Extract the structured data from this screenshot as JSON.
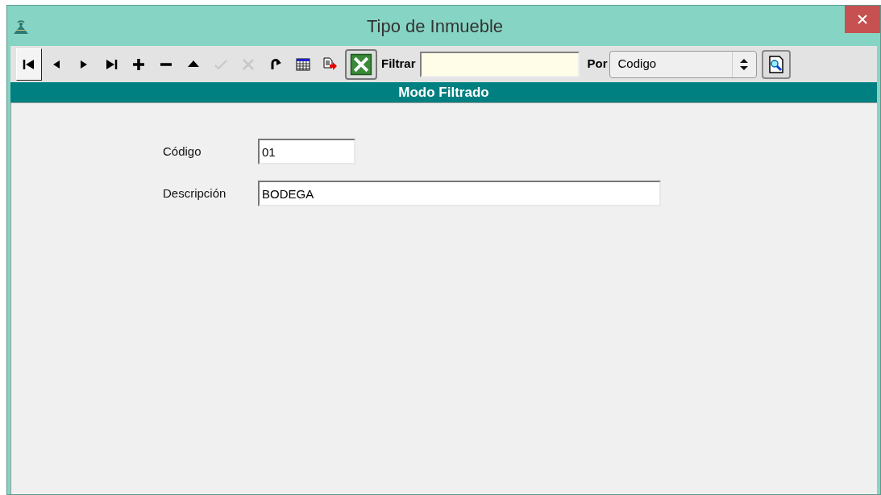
{
  "window": {
    "title": "Tipo de Inmueble"
  },
  "toolbar": {
    "buttons": [
      {
        "kind": "first",
        "pressed": true,
        "disabled": false
      },
      {
        "kind": "prev",
        "pressed": false,
        "disabled": false
      },
      {
        "kind": "next",
        "pressed": false,
        "disabled": false
      },
      {
        "kind": "last",
        "pressed": false,
        "disabled": false
      },
      {
        "kind": "add",
        "pressed": false,
        "disabled": false
      },
      {
        "kind": "remove",
        "pressed": false,
        "disabled": false
      },
      {
        "kind": "up",
        "pressed": false,
        "disabled": false
      },
      {
        "kind": "confirm",
        "pressed": false,
        "disabled": true
      },
      {
        "kind": "cancel",
        "pressed": false,
        "disabled": true
      },
      {
        "kind": "refresh",
        "pressed": false,
        "disabled": false
      },
      {
        "kind": "grid",
        "pressed": false,
        "disabled": false
      },
      {
        "kind": "export",
        "pressed": false,
        "disabled": false
      },
      {
        "kind": "excel",
        "pressed": false,
        "disabled": false
      }
    ],
    "filter_label": "Filtrar",
    "by_label": "Por",
    "by_value": "Codigo"
  },
  "banner": "Modo Filtrado",
  "fields": [
    {
      "kind": "short",
      "label": "Código",
      "value": "01"
    },
    {
      "kind": "long",
      "label": "Descripción",
      "value": "BODEGA"
    }
  ]
}
